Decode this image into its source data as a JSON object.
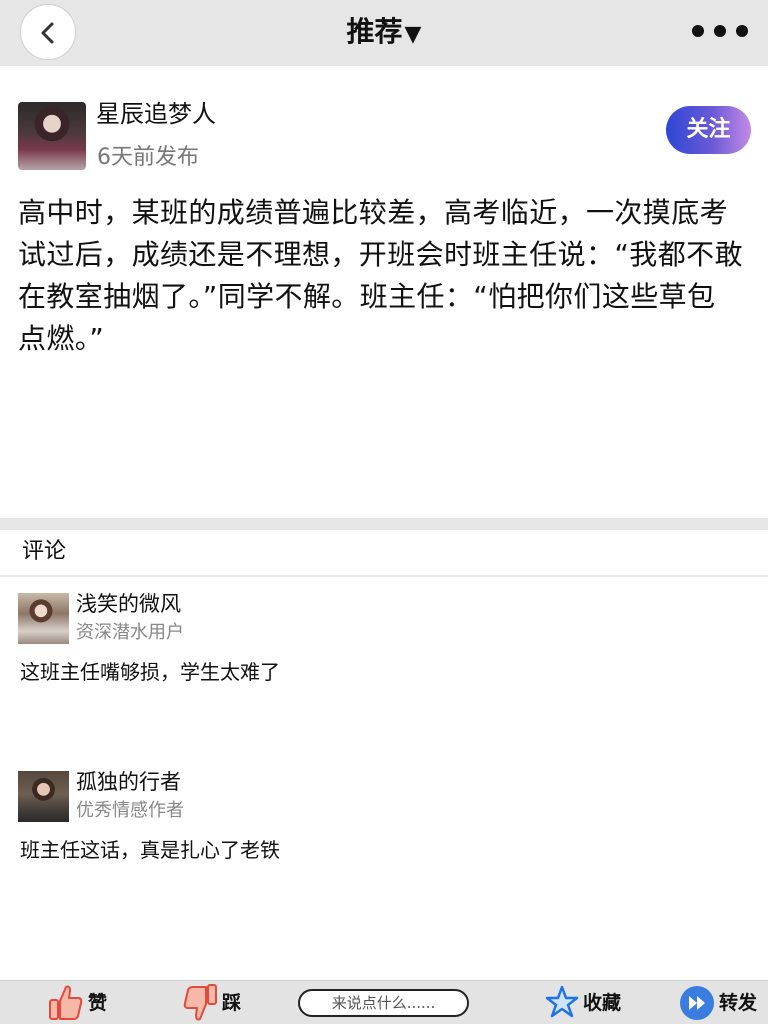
{
  "header": {
    "title": "推荐",
    "title_caret": "▼"
  },
  "post": {
    "author": "星辰追梦人",
    "time": "6天前发布",
    "follow_label": "关注",
    "body": "高中时，某班的成绩普遍比较差，高考临近，一次摸底考试过后，成绩还是不理想，开班会时班主任说：“我都不敢在教室抽烟了。”同学不解。班主任：“怕把你们这些草包点燃。”"
  },
  "comments": {
    "heading": "评论",
    "items": [
      {
        "name": "浅笑的微风",
        "tag": "资深潜水用户",
        "text": "这班主任嘴够损，学生太难了"
      },
      {
        "name": "孤独的行者",
        "tag": "优秀情感作者",
        "text": "班主任这话，真是扎心了老铁"
      }
    ]
  },
  "bottom_bar": {
    "like_label": "赞",
    "dislike_label": "踩",
    "input_placeholder": "来说点什么......",
    "favorite_label": "收藏",
    "share_label": "转发"
  },
  "colors": {
    "header_bg": "#e6e6e6",
    "follow_gradient_start": "#2f47d6",
    "follow_gradient_end": "#c48ae6",
    "star_blue": "#1e73e8",
    "share_blue": "#3a7de0",
    "thumb_red": "#e24a3b"
  }
}
